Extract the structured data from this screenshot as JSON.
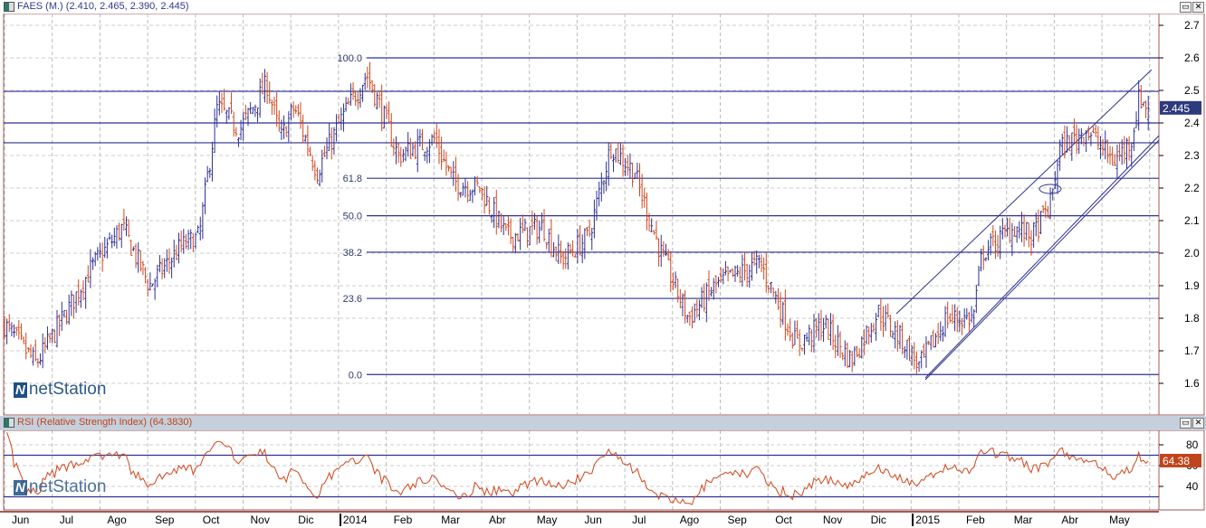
{
  "main_panel": {
    "title": "FAES (M.) (2.410, 2.465, 2.390, 2.445)",
    "last_price": "2.445",
    "restore_label": "▭",
    "close_label": "✕"
  },
  "rsi_panel": {
    "title": "RSI (Relative Strength Index) (64.3830)",
    "last_value": "64.38",
    "restore_label": "▭",
    "close_label": "✕"
  },
  "logo": {
    "text": "netStation"
  },
  "colors": {
    "up": "#2e3192",
    "down": "#d0461c",
    "fib": "#2e3192",
    "rsi": "#d0461c",
    "border": "#a05a5a"
  },
  "chart_data": [
    {
      "type": "ohlc",
      "title": "FAES (M.)",
      "ohlc_last": {
        "open": 2.41,
        "high": 2.465,
        "low": 2.39,
        "close": 2.445
      },
      "ylim": [
        1.55,
        2.72
      ],
      "yticks": [
        "2.7",
        "2.6",
        "2.5",
        "2.4",
        "2.3",
        "2.2",
        "2.1",
        "2.0",
        "1.9",
        "1.8",
        "1.7",
        "1.6"
      ],
      "ytick_values": [
        2.7,
        2.6,
        2.5,
        2.4,
        2.3,
        2.2,
        2.1,
        2.0,
        1.9,
        1.8,
        1.7,
        1.6
      ],
      "x_labels": [
        "Jun",
        "Jul",
        "Ago",
        "Sep",
        "Oct",
        "Nov",
        "Dic",
        "2014",
        "Feb",
        "Mar",
        "Abr",
        "May",
        "Jun",
        "Jul",
        "Ago",
        "Sep",
        "Oct",
        "Nov",
        "Dic",
        "2015",
        "Feb",
        "Mar",
        "Abr",
        "May"
      ],
      "close_path_months_price": [
        [
          0,
          1.78
        ],
        [
          0.66,
          1.66
        ],
        [
          1.23,
          1.8
        ],
        [
          1.8,
          1.95
        ],
        [
          2.47,
          2.08
        ],
        [
          3.04,
          1.9
        ],
        [
          3.7,
          2.02
        ],
        [
          4.08,
          2.05
        ],
        [
          4.46,
          2.45
        ],
        [
          4.93,
          2.38
        ],
        [
          5.5,
          2.52
        ],
        [
          5.79,
          2.35
        ],
        [
          6.07,
          2.45
        ],
        [
          6.55,
          2.25
        ],
        [
          7.02,
          2.4
        ],
        [
          7.59,
          2.55
        ],
        [
          7.87,
          2.45
        ],
        [
          8.25,
          2.3
        ],
        [
          9.01,
          2.35
        ],
        [
          9.39,
          2.22
        ],
        [
          9.96,
          2.2
        ],
        [
          10.53,
          2.05
        ],
        [
          11.29,
          2.08
        ],
        [
          11.67,
          1.98
        ],
        [
          12.24,
          2.05
        ],
        [
          12.71,
          2.33
        ],
        [
          13.19,
          2.25
        ],
        [
          13.76,
          2.0
        ],
        [
          14.33,
          1.8
        ],
        [
          14.9,
          1.9
        ],
        [
          15.84,
          1.97
        ],
        [
          16.6,
          1.72
        ],
        [
          17.17,
          1.78
        ],
        [
          17.74,
          1.67
        ],
        [
          18.31,
          1.82
        ],
        [
          18.88,
          1.72
        ],
        [
          19.17,
          1.65
        ],
        [
          19.73,
          1.8
        ],
        [
          20.3,
          1.8
        ],
        [
          20.49,
          2.0
        ],
        [
          21.16,
          2.08
        ],
        [
          21.54,
          2.05
        ],
        [
          21.92,
          2.15
        ],
        [
          22.11,
          2.32
        ],
        [
          22.68,
          2.38
        ],
        [
          23.25,
          2.28
        ],
        [
          23.62,
          2.35
        ],
        [
          23.78,
          2.48
        ],
        [
          23.97,
          2.445
        ]
      ],
      "horizontal_lines": [
        2.497,
        2.4,
        2.339
      ],
      "fibonacci": [
        {
          "label": "100.0",
          "price": 2.6
        },
        {
          "label": "61.8",
          "price": 2.23
        },
        {
          "label": "50.0",
          "price": 2.115
        },
        {
          "label": "38.2",
          "price": 2.003
        },
        {
          "label": "23.6",
          "price": 1.861
        },
        {
          "label": "0.0",
          "price": 1.627
        }
      ]
    },
    {
      "type": "line",
      "title": "RSI (Relative Strength Index)",
      "last": 64.383,
      "ylim": [
        20,
        95
      ],
      "yticks": [
        "80",
        "60",
        "40"
      ],
      "ytick_values": [
        80,
        60,
        40
      ],
      "levels": [
        70,
        30
      ]
    }
  ]
}
